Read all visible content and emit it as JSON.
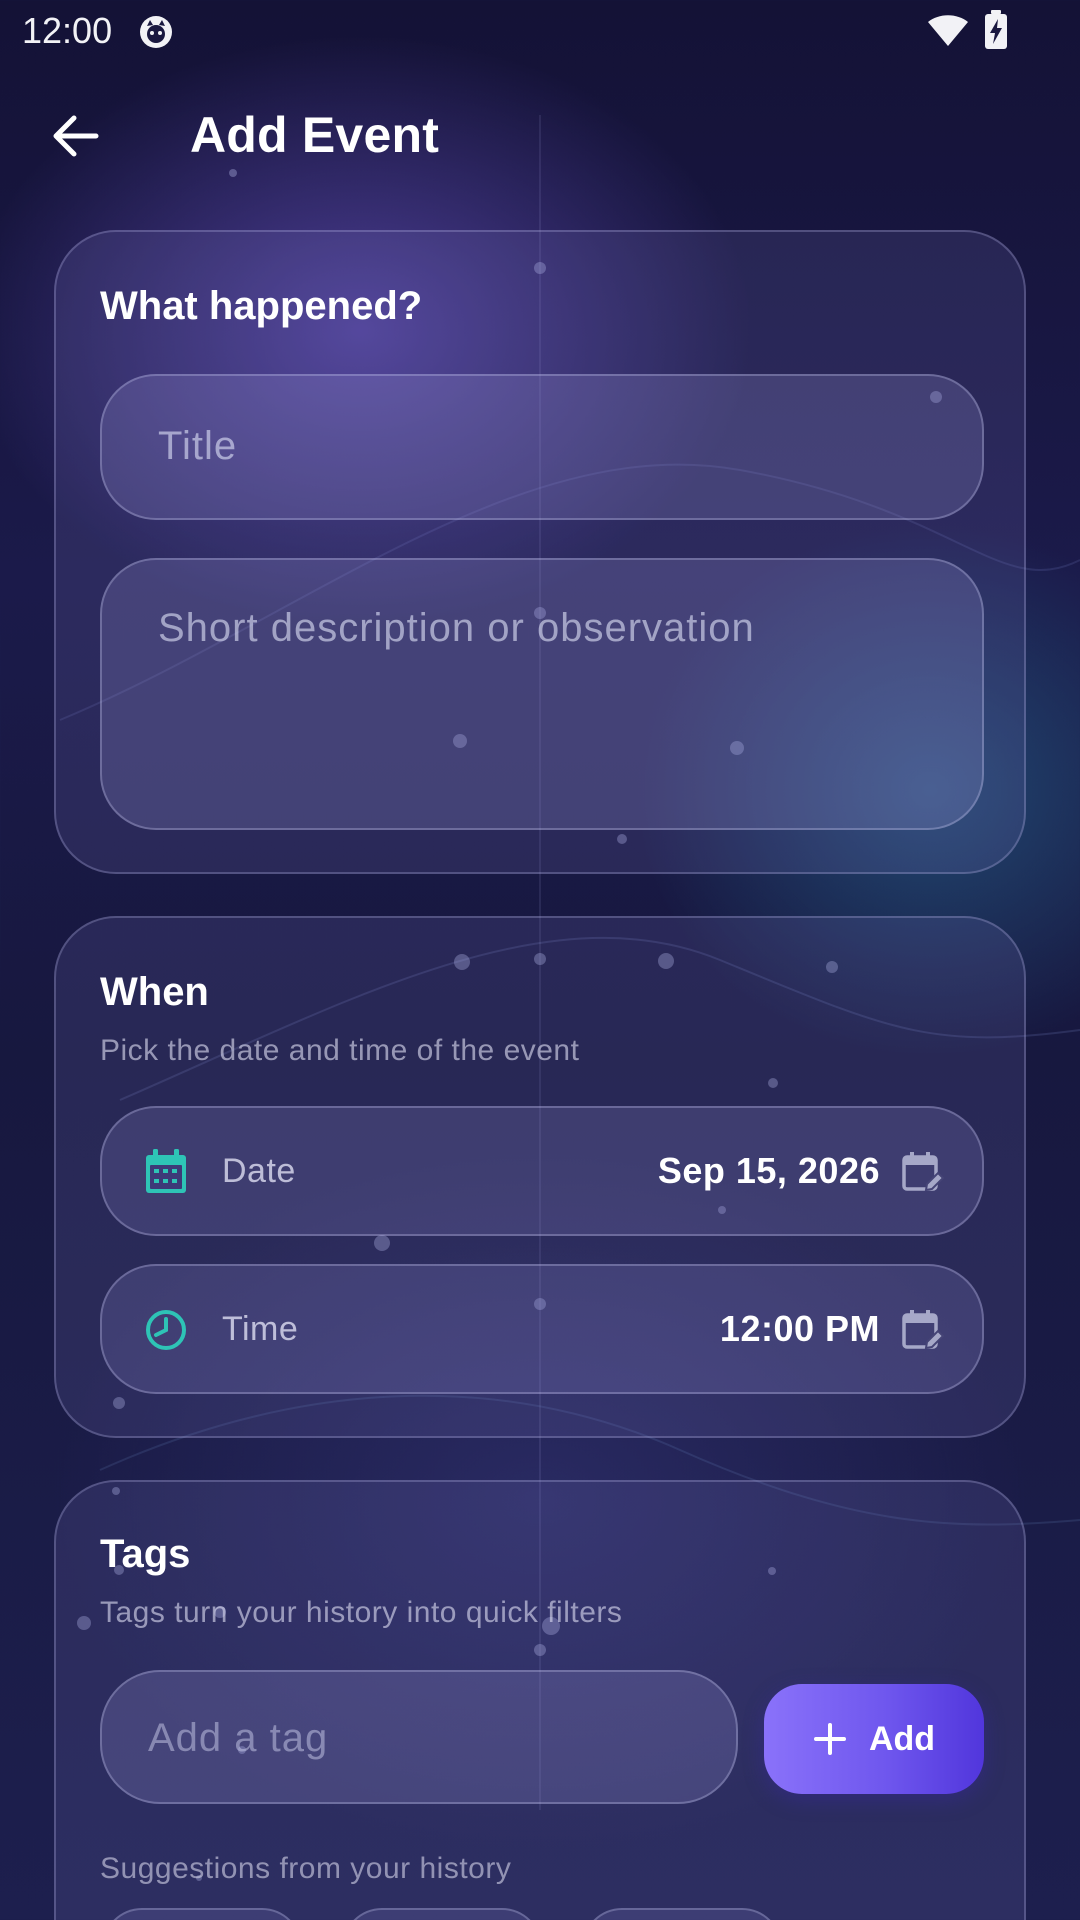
{
  "status_bar": {
    "time": "12:00",
    "icons": [
      "app-notification-icon",
      "wifi-icon",
      "battery-charging-icon"
    ]
  },
  "header": {
    "back_icon": "arrow-left-icon",
    "title": "Add Event"
  },
  "what_card": {
    "title": "What happened?",
    "title_placeholder": "Title",
    "description_placeholder": "Short description or observation"
  },
  "when_card": {
    "title": "When",
    "subtitle": "Pick the date and time of the event",
    "date": {
      "label": "Date",
      "value": "Sep 15, 2026",
      "icon": "calendar-icon",
      "action_icon": "calendar-edit-icon"
    },
    "time": {
      "label": "Time",
      "value": "12:00 PM",
      "icon": "clock-icon",
      "action_icon": "calendar-edit-icon"
    }
  },
  "tags_card": {
    "title": "Tags",
    "subtitle": "Tags turn your history into quick filters",
    "input_placeholder": "Add a tag",
    "add_button_label": "Add",
    "suggestions_label": "Suggestions from your history"
  },
  "colors": {
    "accent_teal": "#2ec4b6",
    "button_start": "#8a72fa",
    "button_end": "#5136dc"
  }
}
